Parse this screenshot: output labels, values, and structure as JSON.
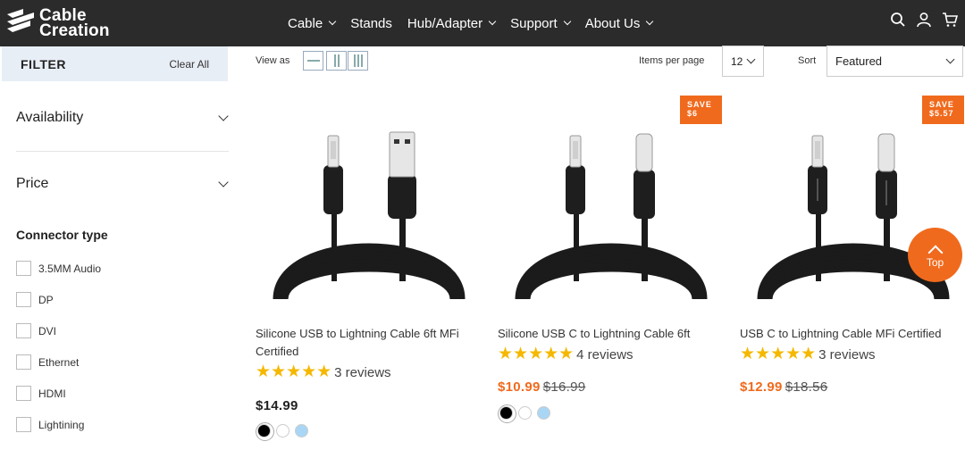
{
  "brand": {
    "line1": "Cable",
    "line2": "Creation"
  },
  "nav": [
    {
      "label": "Cable",
      "dropdown": true
    },
    {
      "label": "Stands",
      "dropdown": false
    },
    {
      "label": "Hub/Adapter",
      "dropdown": true
    },
    {
      "label": "Support",
      "dropdown": true
    },
    {
      "label": "About Us",
      "dropdown": true
    }
  ],
  "header_icons": [
    "search-icon",
    "account-icon",
    "cart-icon"
  ],
  "filter": {
    "title": "FILTER",
    "clear": "Clear All",
    "facets": [
      "Availability",
      "Price"
    ],
    "connector_title": "Connector type",
    "connector_options": [
      "3.5MM Audio",
      "DP",
      "DVI",
      "Ethernet",
      "HDMI",
      "Lightining"
    ]
  },
  "toolbar": {
    "view_as": "View as",
    "items_per_page_label": "Items per page",
    "items_per_page": "12",
    "sort_label": "Sort",
    "sort_value": "Featured"
  },
  "products": [
    {
      "title": "Silicone USB to Lightning Cable 6ft MFi Certified",
      "badge": "",
      "stars": "★★★★★",
      "reviews": "3 reviews",
      "price": "$14.99",
      "old_price": "",
      "on_sale": false,
      "plug": "usb-a",
      "swatches": [
        "#000000",
        "#ffffff",
        "#a9d6f5"
      ]
    },
    {
      "title": "Silicone USB C to Lightning Cable 6ft",
      "badge": "SAVE\n$6",
      "stars": "★★★★★",
      "reviews": "4 reviews",
      "price": "$10.99",
      "old_price": "$16.99",
      "on_sale": true,
      "plug": "usb-c",
      "swatches": [
        "#000000",
        "#ffffff",
        "#a9d6f5"
      ]
    },
    {
      "title": "USB C to Lightning Cable MFi Certified",
      "badge": "SAVE\n$5.57",
      "stars": "★★★★★",
      "reviews": "3 reviews",
      "price": "$12.99",
      "old_price": "$18.56",
      "on_sale": true,
      "plug": "usb-c-braided",
      "swatches": []
    }
  ],
  "back_to_top": "Top",
  "colors": {
    "accent": "#f06a1d",
    "header": "#2b2b2b",
    "star": "#f5b800",
    "filter_bg": "#e8eef6"
  }
}
